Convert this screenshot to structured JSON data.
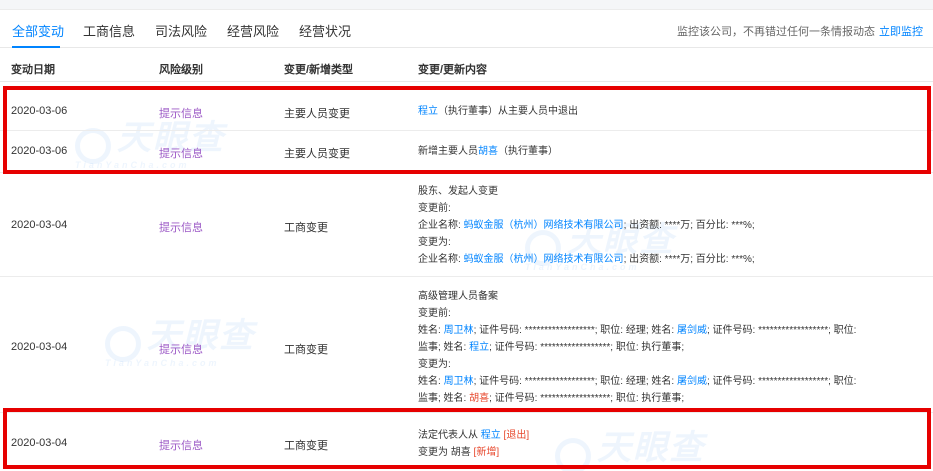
{
  "tabs": [
    {
      "label": "全部变动"
    },
    {
      "label": "工商信息"
    },
    {
      "label": "司法风险"
    },
    {
      "label": "经营风险"
    },
    {
      "label": "经营状况"
    }
  ],
  "notice": {
    "text": "监控该公司，不再错过任何一条情报动态",
    "link": "立即监控"
  },
  "headers": {
    "date": "变动日期",
    "risk": "风险级别",
    "type": "变更/新增类型",
    "content": "变更/更新内容"
  },
  "watermark": {
    "brand": "天眼查",
    "sub": "TianYanCha.com"
  },
  "rows": [
    {
      "date": "2020-03-06",
      "risk": "提示信息",
      "type": "主要人员变更",
      "lines": [
        {
          "l1": "程立",
          "t1": "（执行董事）从主要人员中退出"
        }
      ]
    },
    {
      "date": "2020-03-06",
      "risk": "提示信息",
      "type": "主要人员变更",
      "lines": [
        {
          "t0": "新增主要人员",
          "l1": "胡喜",
          "t1": "（执行董事）"
        }
      ]
    },
    {
      "date": "2020-03-04",
      "risk": "提示信息",
      "type": "工商变更",
      "lines": [
        {
          "t0": "股东、发起人变更"
        },
        {
          "t0": "变更前:"
        },
        {
          "t0": "企业名称: ",
          "l1": "蚂蚁金服（杭州）网络技术有限公司",
          "t1": "; 出资额: ****万; 百分比: ***%;"
        },
        {
          "t0": "变更为:"
        },
        {
          "t0": "企业名称: ",
          "l1": "蚂蚁金服（杭州）网络技术有限公司",
          "t1": "; 出资额: ****万; 百分比: ***%;"
        }
      ]
    },
    {
      "date": "2020-03-04",
      "risk": "提示信息",
      "type": "工商变更",
      "lines": [
        {
          "t0": "高级管理人员备案"
        },
        {
          "t0": "变更前:"
        },
        {
          "t0": "姓名: ",
          "l1": "周卫林",
          "t1": "; 证件号码: ******************; 职位: 经理; 姓名: ",
          "l2": "屠剑威",
          "t2": "; 证件号码: ******************; 职位:"
        },
        {
          "t0": "监事; 姓名: ",
          "l1": "程立",
          "t1": "; 证件号码: ******************; 职位: 执行董事;"
        },
        {
          "t0": "变更为:"
        },
        {
          "t0": "姓名: ",
          "l1": "周卫林",
          "t1": "; 证件号码: ******************; 职位: 经理; 姓名: ",
          "l2": "屠剑威",
          "t2": "; 证件号码: ******************; 职位:"
        },
        {
          "t0": "监事; 姓名: ",
          "r1": "胡喜",
          "t1": "; 证件号码: ******************; 职位: 执行董事;"
        }
      ]
    },
    {
      "date": "2020-03-04",
      "risk": "提示信息",
      "type": "工商变更",
      "lines": [
        {
          "t0": "法定代表人从 ",
          "l1": "程立",
          "r1": " [退出]"
        },
        {
          "t0": "变更为 胡喜",
          "r1": " [新增]"
        }
      ]
    }
  ]
}
